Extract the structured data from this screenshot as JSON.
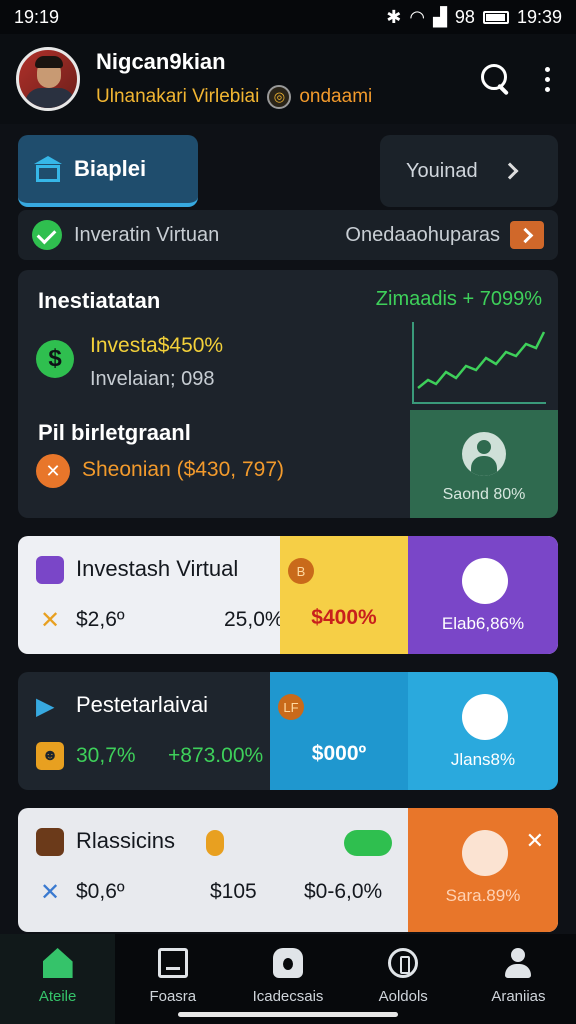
{
  "status": {
    "time_left": "19:19",
    "battery": "98",
    "time_right": "19:39"
  },
  "header": {
    "user_name": "Nigcan9kian",
    "subtitle": "Ulnanakari Virlebiai",
    "coin_label": "ondaami"
  },
  "tabs": {
    "active_label": "Biaplei",
    "right_label": "Youinad"
  },
  "info_bar": {
    "left_text": "Inveratin Virtuan",
    "right_text": "Onedaaohuparas"
  },
  "investment": {
    "title": "Inestiatatan",
    "gain": "Zimaadis + 7099%",
    "value": "Investa$450%",
    "sub_value": "Invelaian; 098",
    "pl_title": "Pil birletgraanl",
    "pl_value": "Sheonian ($430, 797)",
    "score_label": "Saond 80%"
  },
  "cards": [
    {
      "title": "Investash Virtual",
      "v1": "$2,6º",
      "v2": "25,0%",
      "mid_badge": "B",
      "mid_value": "$400%",
      "right_label": "Elab6,86%"
    },
    {
      "title": "Pestetarlaivai",
      "v1": "30,7%",
      "v2": "+873.00%",
      "mid_badge": "LF",
      "mid_value": "$000º",
      "right_label": "Jlans8%"
    },
    {
      "title": "Rlassicins",
      "v1": "$0,6º",
      "v2": "$105",
      "v3": "$0-6,0%",
      "mid_badge": "",
      "mid_value": "",
      "right_label": "Sara.89%"
    }
  ],
  "nav": [
    {
      "label": "Ateile"
    },
    {
      "label": "Foasra"
    },
    {
      "label": "Icadecsais"
    },
    {
      "label": "Aoldols"
    },
    {
      "label": "Araniias"
    }
  ],
  "colors": {
    "accent_green": "#35c36a",
    "accent_blue": "#37a9e0",
    "accent_orange": "#e8762a",
    "accent_purple": "#7a46c8",
    "accent_yellow": "#f6cf46"
  }
}
